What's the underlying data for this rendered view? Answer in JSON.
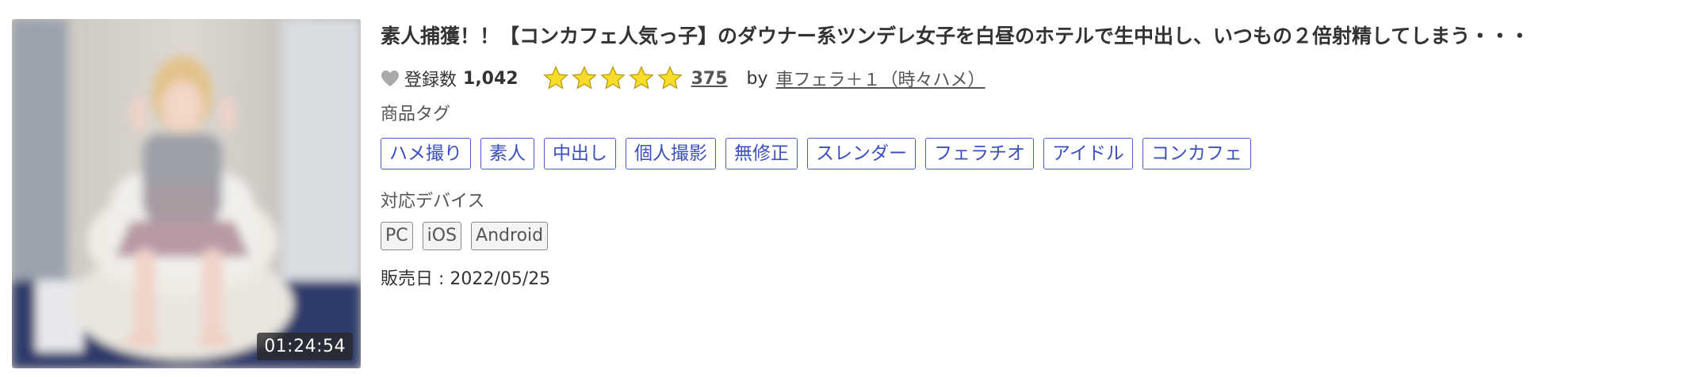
{
  "product": {
    "title": "素人捕獲！！【コンカフェ人気っ子】のダウナー系ツンデレ女子を白昼のホテルで生中出し、いつもの２倍射精してしまう・・・",
    "duration": "01:24:54",
    "favorites": {
      "label": "登録数",
      "count": "1,042"
    },
    "rating": {
      "stars": 5,
      "review_count": "375"
    },
    "by_label": "by",
    "seller": "車フェラ＋１（時々ハメ）",
    "tags_label": "商品タグ",
    "tags": [
      "ハメ撮り",
      "素人",
      "中出し",
      "個人撮影",
      "無修正",
      "スレンダー",
      "フェラチオ",
      "アイドル",
      "コンカフェ"
    ],
    "devices_label": "対応デバイス",
    "devices": [
      "PC",
      "iOS",
      "Android"
    ],
    "release": {
      "label": "販売日",
      "separator": " : ",
      "value": "2022/05/25"
    }
  },
  "icons": {
    "favorite": "heart-icon",
    "rating": "star-icon"
  },
  "colors": {
    "tag_border": "#4a5ec2",
    "tag_text": "#3b4fbd",
    "star_fill": "#f5dd2a",
    "star_stroke": "#b89a10",
    "heart": "#aaaaaa"
  }
}
